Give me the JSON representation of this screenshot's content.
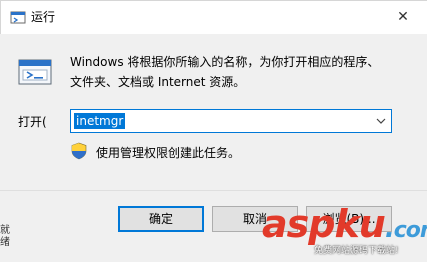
{
  "window": {
    "title": "运行",
    "close_symbol": "✕"
  },
  "description": {
    "line1": "Windows 将根据你所输入的名称，为你打开相应的程序、",
    "line2": "文件夹、文档或 Internet 资源。"
  },
  "open_field": {
    "label": "打开(O):",
    "label_display": "打开(",
    "value": "inetmgr"
  },
  "admin_note": "使用管理权限创建此任务。",
  "buttons": {
    "ok": "确定",
    "cancel": "取消",
    "browse": "浏览(B)..."
  },
  "left_edge_text": "就绪",
  "watermark": {
    "main": "asp",
    "k": "k",
    "u": "u",
    "dot": ".",
    "cn": "com",
    "sub": "免费网站源码下载站!"
  },
  "icons": {
    "title_icon": "run-app-icon",
    "big_icon": "run-app-icon",
    "shield": "uac-shield-icon",
    "close": "close-icon",
    "dropdown": "chevron-down-icon"
  },
  "colors": {
    "accent": "#0078d7",
    "watermark_red": "#e23a2a",
    "watermark_blue": "#3d9bd9"
  }
}
